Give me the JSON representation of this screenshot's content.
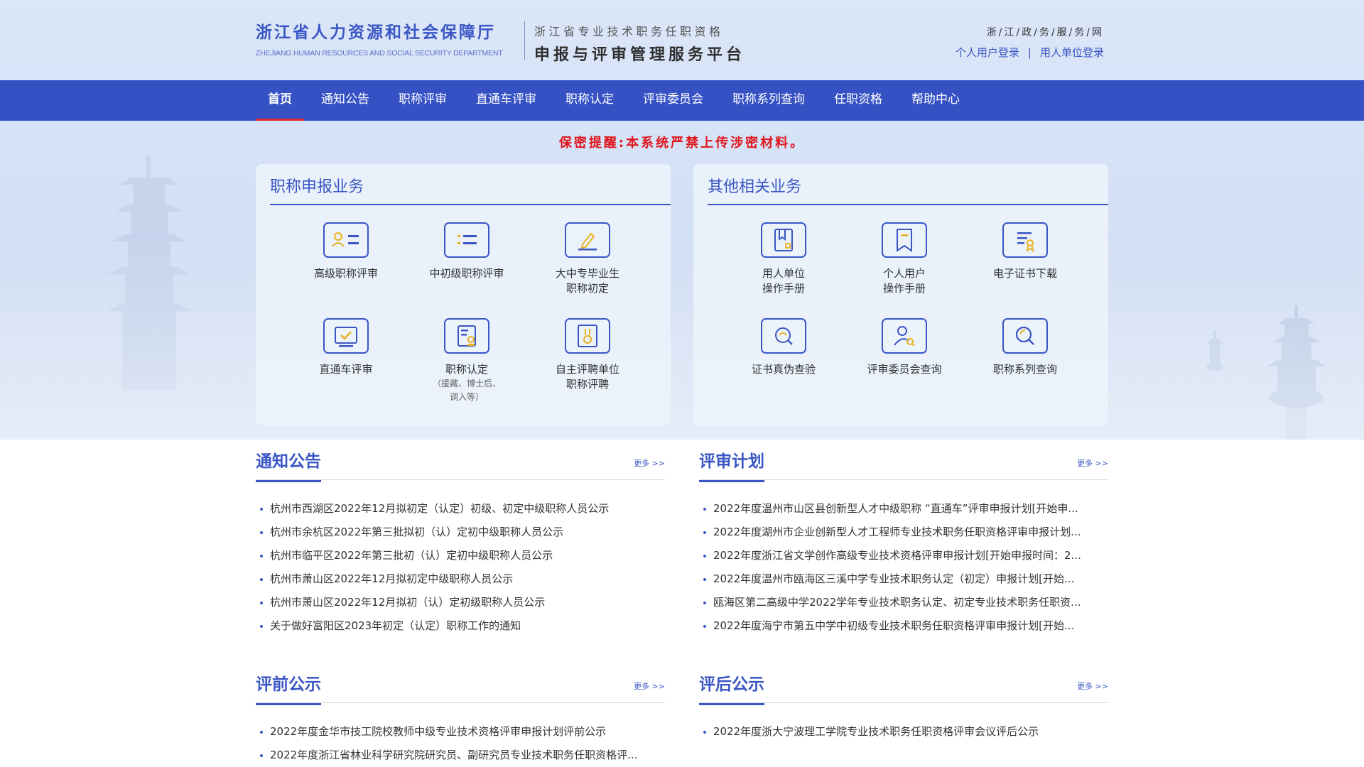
{
  "header": {
    "dept_cn": "浙江省人力资源和社会保障厅",
    "dept_en": "ZHEJIANG HUMAN RESOURCES AND SOCIAL SECURITY DEPARTMENT",
    "platform_sub": "浙江省专业技术职务任职资格",
    "platform_main": "申报与评审管理服务平台",
    "gov_link": "浙/江/政/务/服/务/网",
    "personal_login": "个人用户登录",
    "login_sep": "|",
    "unit_login": "用人单位登录"
  },
  "nav": {
    "items": [
      "首页",
      "通知公告",
      "职称评审",
      "直通车评审",
      "职称认定",
      "评审委员会",
      "职称系列查询",
      "任职资格",
      "帮助中心"
    ],
    "active": "首页"
  },
  "secret_notice": "保密提醒:本系统严禁上传涉密材料。",
  "panels": {
    "left": {
      "title": "职称申报业务",
      "services": [
        {
          "label": "高级职称评审",
          "icon": "id-card-icon"
        },
        {
          "label": "中初级职称评审",
          "icon": "list-icon"
        },
        {
          "label": "大中专毕业生\n职称初定",
          "icon": "pen-edit-icon"
        },
        {
          "label": "直通车评审",
          "icon": "screen-check-icon"
        },
        {
          "label": "职称认定",
          "note": "（援藏、博士后、\n调入等）",
          "icon": "certificate-stamp-icon"
        },
        {
          "label": "自主评聘单位\n职称评聘",
          "icon": "medal-card-icon"
        }
      ]
    },
    "right": {
      "title": "其他相关业务",
      "services": [
        {
          "label": "用人单位\n操作手册",
          "icon": "manual-book-icon"
        },
        {
          "label": "个人用户\n操作手册",
          "icon": "bookmark-icon"
        },
        {
          "label": "电子证书下载",
          "icon": "certificate-download-icon"
        },
        {
          "label": "证书真伪查验",
          "icon": "verify-search-icon"
        },
        {
          "label": "评审委员会查询",
          "icon": "user-search-icon"
        },
        {
          "label": "职称系列查询",
          "icon": "search-icon"
        }
      ]
    }
  },
  "sections": {
    "notices": {
      "title": "通知公告",
      "more": "更多 >>",
      "items": [
        "杭州市西湖区2022年12月拟初定（认定）初级、初定中级职称人员公示",
        "杭州市余杭区2022年第三批拟初（认）定初中级职称人员公示",
        "杭州市临平区2022年第三批初（认）定初中级职称人员公示",
        "杭州市萧山区2022年12月拟初定中级职称人员公示",
        "杭州市萧山区2022年12月拟初（认）定初级职称人员公示",
        "关于做好富阳区2023年初定（认定）职称工作的通知"
      ]
    },
    "plans": {
      "title": "评审计划",
      "more": "更多 >>",
      "items": [
        "2022年度温州市山区县创新型人才中级职称 “直通车”评审申报计划[开始申...",
        "2022年度湖州市企业创新型人才工程师专业技术职务任职资格评审申报计划...",
        "2022年度浙江省文学创作高级专业技术资格评审申报计划[开始申报时间：2...",
        "2022年度温州市瓯海区三溪中学专业技术职务认定（初定）申报计划[开始...",
        "瓯海区第二高级中学2022学年专业技术职务认定、初定专业技术职务任职资...",
        "2022年度海宁市第五中学中初级专业技术职务任职资格评审申报计划[开始..."
      ]
    },
    "pre_review": {
      "title": "评前公示",
      "more": "更多 >>",
      "items": [
        "2022年度金华市技工院校教师中级专业技术资格评审申报计划评前公示",
        "2022年度浙江省林业科学研究院研究员、副研究员专业技术职务任职资格评..."
      ]
    },
    "post_review": {
      "title": "评后公示",
      "more": "更多 >>",
      "items": [
        "2022年度浙大宁波理工学院专业技术职务任职资格评审会议评后公示"
      ]
    }
  },
  "colors": {
    "brand_blue": "#3651c4",
    "accent_red": "#e0272b",
    "notice_red": "#e0151c"
  }
}
